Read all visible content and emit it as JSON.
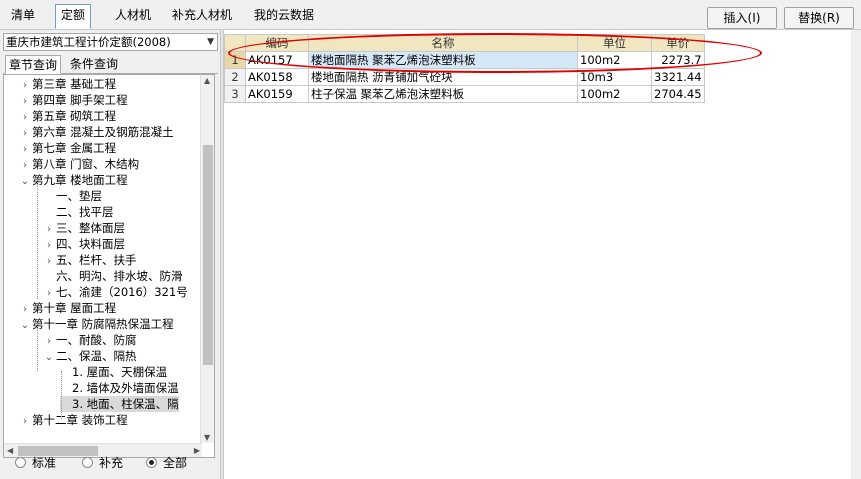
{
  "top_tabs": [
    {
      "label": "清单",
      "active": false
    },
    {
      "label": "定额",
      "active": true
    },
    {
      "label": "人材机",
      "active": false
    },
    {
      "label": "补充人材机",
      "active": false
    },
    {
      "label": "我的云数据",
      "active": false
    }
  ],
  "buttons": {
    "insert": "插入(I)",
    "replace": "替换(R)"
  },
  "library": {
    "selected": "重庆市建筑工程计价定额(2008)"
  },
  "sub_tabs": [
    {
      "label": "章节查询",
      "active": true
    },
    {
      "label": "条件查询",
      "active": false
    }
  ],
  "tree": [
    {
      "label": "第三章 基础工程",
      "expander": "collapsed"
    },
    {
      "label": "第四章 脚手架工程",
      "expander": "collapsed"
    },
    {
      "label": "第五章 砌筑工程",
      "expander": "collapsed"
    },
    {
      "label": "第六章 混凝土及钢筋混凝土",
      "expander": "collapsed"
    },
    {
      "label": "第七章 金属工程",
      "expander": "collapsed"
    },
    {
      "label": "第八章 门窗、木结构",
      "expander": "collapsed"
    },
    {
      "label": "第九章 楼地面工程",
      "expander": "expanded"
    },
    {
      "label": "一、垫层",
      "expander": "none"
    },
    {
      "label": "二、找平层",
      "expander": "none"
    },
    {
      "label": "三、整体面层",
      "expander": "collapsed"
    },
    {
      "label": "四、块料面层",
      "expander": "collapsed"
    },
    {
      "label": "五、栏杆、扶手",
      "expander": "collapsed"
    },
    {
      "label": "六、明沟、排水坡、防滑",
      "expander": "none"
    },
    {
      "label": "七、渝建（2016）321号",
      "expander": "collapsed"
    },
    {
      "label": "第十章 屋面工程",
      "expander": "collapsed"
    },
    {
      "label": "第十一章 防腐隔热保温工程",
      "expander": "expanded"
    },
    {
      "label": "一、耐酸、防腐",
      "expander": "collapsed"
    },
    {
      "label": "二、保温、隔热",
      "expander": "expanded"
    },
    {
      "label": "1. 屋面、天棚保温",
      "expander": "none"
    },
    {
      "label": "2. 墙体及外墙面保温",
      "expander": "none"
    },
    {
      "label": "3. 地面、柱保温、隔",
      "expander": "none",
      "selected": true
    },
    {
      "label": "第十二章 装饰工程",
      "expander": "collapsed"
    }
  ],
  "filters": [
    {
      "label": "标准",
      "checked": false
    },
    {
      "label": "补充",
      "checked": false
    },
    {
      "label": "全部",
      "checked": true
    }
  ],
  "grid": {
    "columns": [
      "",
      "编码",
      "名称",
      "单位",
      "单价"
    ],
    "rows": [
      {
        "index": "1",
        "code": "AK0157",
        "name": "楼地面隔热 聚苯乙烯泡沫塑料板",
        "unit": "100m2",
        "price": "2273.7"
      },
      {
        "index": "2",
        "code": "AK0158",
        "name": "楼地面隔热 沥青铺加气砼块",
        "unit": "10m3",
        "price": "3321.44"
      },
      {
        "index": "3",
        "code": "AK0159",
        "name": "柱子保温 聚苯乙烯泡沫塑料板",
        "unit": "100m2",
        "price": "2704.45"
      }
    ],
    "selected_row": 0
  },
  "annotation_color": "#e00000"
}
